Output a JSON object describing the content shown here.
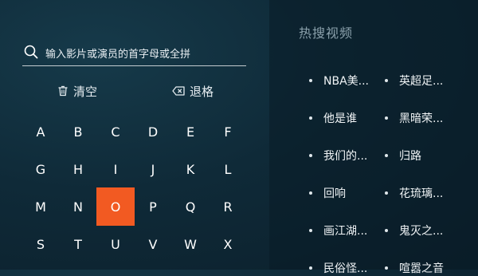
{
  "search": {
    "placeholder_text": "输入影片或演员的首字母或全拼",
    "icon": "search-icon"
  },
  "actions": {
    "clear_label": "清空",
    "backspace_label": "退格"
  },
  "keyboard": {
    "keys": [
      "A",
      "B",
      "C",
      "D",
      "E",
      "F",
      "G",
      "H",
      "I",
      "J",
      "K",
      "L",
      "M",
      "N",
      "O",
      "P",
      "Q",
      "R",
      "S",
      "T",
      "U",
      "V",
      "W",
      "X"
    ],
    "selected": "O",
    "accent_color": "#f25a22"
  },
  "hot": {
    "title": "热搜视频",
    "items": [
      "NBA美...",
      "英超足...",
      "他是谁",
      "黑暗荣...",
      "我们的...",
      "归路",
      "回响",
      "花琉璃...",
      "画江湖...",
      "鬼灭之...",
      "民俗怪...",
      "喧嚣之音"
    ]
  }
}
